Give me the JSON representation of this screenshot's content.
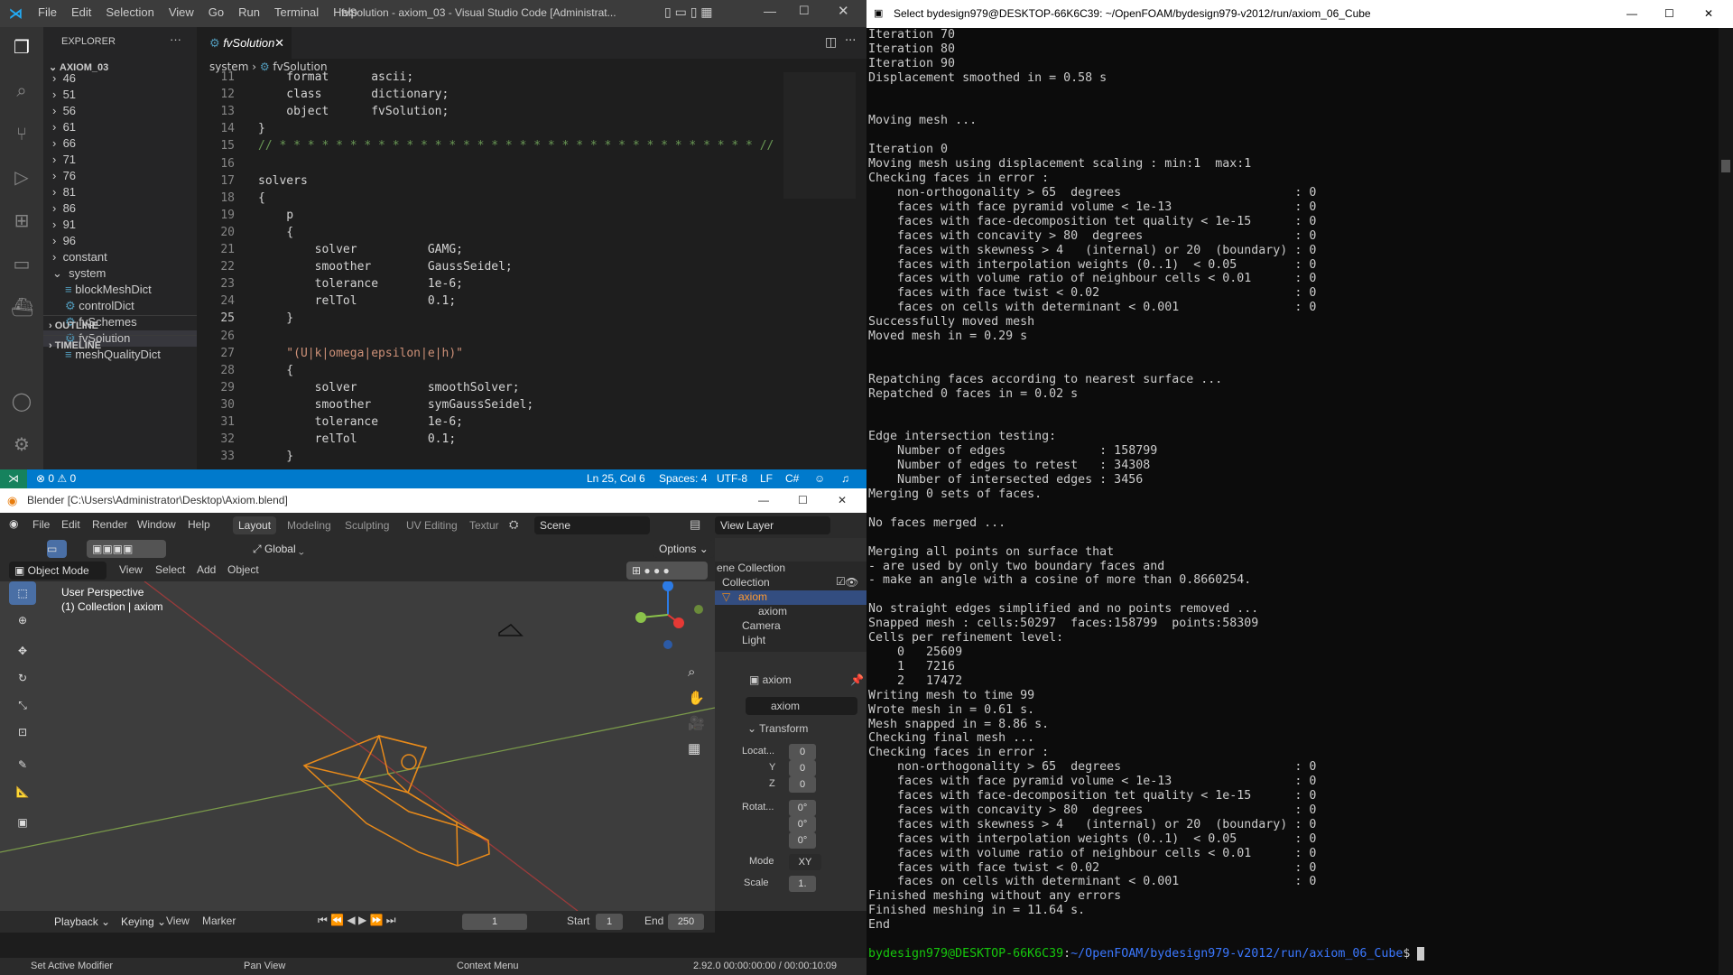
{
  "vscode": {
    "menu": [
      "File",
      "Edit",
      "Selection",
      "View",
      "Go",
      "Run",
      "Terminal",
      "Help"
    ],
    "title": "fvSolution - axiom_03 - Visual Studio Code [Administrat...",
    "explorer_label": "EXPLORER",
    "project": "AXIOM_03",
    "folders": [
      "46",
      "51",
      "56",
      "61",
      "66",
      "71",
      "76",
      "81",
      "86",
      "91",
      "96",
      "constant"
    ],
    "system_folder": "system",
    "system_files": [
      {
        "name": "blockMeshDict",
        "icon": "≡"
      },
      {
        "name": "controlDict",
        "icon": "⚙"
      },
      {
        "name": "fvSchemes",
        "icon": "⚙"
      },
      {
        "name": "fvSolution",
        "icon": "⚙"
      },
      {
        "name": "meshQualityDict",
        "icon": "≡"
      }
    ],
    "outline": "OUTLINE",
    "timeline": "TIMELINE",
    "tab": "fvSolution",
    "breadcrumb": [
      "system",
      "fvSolution"
    ],
    "code_lines": [
      {
        "n": "11",
        "t": "    format      ascii;"
      },
      {
        "n": "12",
        "t": "    class       dictionary;"
      },
      {
        "n": "13",
        "t": "    object      fvSolution;"
      },
      {
        "n": "14",
        "t": "}"
      },
      {
        "n": "15",
        "t": "// * * * * * * * * * * * * * * * * * * * * * * * * * * * * * * * * * * //"
      },
      {
        "n": "16",
        "t": ""
      },
      {
        "n": "17",
        "t": "solvers"
      },
      {
        "n": "18",
        "t": "{"
      },
      {
        "n": "19",
        "t": "    p"
      },
      {
        "n": "20",
        "t": "    {"
      },
      {
        "n": "21",
        "t": "        solver          GAMG;"
      },
      {
        "n": "22",
        "t": "        smoother        GaussSeidel;"
      },
      {
        "n": "23",
        "t": "        tolerance       1e-6;"
      },
      {
        "n": "24",
        "t": "        relTol          0.1;"
      },
      {
        "n": "25",
        "t": "    }"
      },
      {
        "n": "26",
        "t": ""
      },
      {
        "n": "27",
        "t": "    \"(U|k|omega|epsilon|e|h)\""
      },
      {
        "n": "28",
        "t": "    {"
      },
      {
        "n": "29",
        "t": "        solver          smoothSolver;"
      },
      {
        "n": "30",
        "t": "        smoother        symGaussSeidel;"
      },
      {
        "n": "31",
        "t": "        tolerance       1e-6;"
      },
      {
        "n": "32",
        "t": "        relTol          0.1;"
      },
      {
        "n": "33",
        "t": "    }"
      }
    ],
    "status": {
      "errors": "0",
      "warnings": "0",
      "position": "Ln 25, Col 6",
      "spaces": "Spaces: 4",
      "encoding": "UTF-8",
      "eol": "LF",
      "lang": "C#"
    }
  },
  "blender": {
    "title": "Blender [C:\\Users\\Administrator\\Desktop\\Axiom.blend]",
    "menu": [
      "File",
      "Edit",
      "Render",
      "Window",
      "Help"
    ],
    "workspaces": [
      "Layout",
      "Modeling",
      "Sculpting",
      "UV Editing",
      "Textur"
    ],
    "scene": "Scene",
    "view_layer": "View Layer",
    "orientation": "Global",
    "options": "Options",
    "mode": "Object Mode",
    "header_menu": [
      "View",
      "Select",
      "Add",
      "Object"
    ],
    "viewport_info": [
      "User Perspective",
      "(1) Collection | axiom"
    ],
    "outliner": {
      "root": "ene Collection",
      "collection": "Collection",
      "items": [
        "axiom",
        "axiom",
        "Camera",
        "Light"
      ]
    },
    "props": {
      "object": "axiom",
      "data": "axiom",
      "panel": "Transform",
      "loc_label": "Locat...",
      "rot_label": "Rotat...",
      "y": "Y",
      "z": "Z",
      "loc": [
        "0",
        "0",
        "0"
      ],
      "rot": [
        "0°",
        "0°",
        "0°"
      ],
      "mode_label": "Mode",
      "mode_value": "XY",
      "scale_label": "Scale",
      "scale_value": "1."
    },
    "timeline": {
      "menu": [
        "Playback",
        "Keying",
        "View",
        "Marker"
      ],
      "frame": "1",
      "start_label": "Start",
      "start": "1",
      "end_label": "End",
      "end": "250"
    },
    "statusbar": {
      "left": "Set Active Modifier",
      "mid": "Pan View",
      "ctx": "Context Menu",
      "version": "2.92.0  00:00:00:00 / 00:00:10:09"
    }
  },
  "terminal": {
    "title": "Select bydesign979@DESKTOP-66K6C39: ~/OpenFOAM/bydesign979-v2012/run/axiom_06_Cube",
    "lines": [
      "Iteration 70",
      "Iteration 80",
      "Iteration 90",
      "Displacement smoothed in = 0.58 s",
      "",
      "",
      "Moving mesh ...",
      "",
      "Iteration 0",
      "Moving mesh using displacement scaling : min:1  max:1",
      "Checking faces in error :",
      "    non-orthogonality > 65  degrees                        : 0",
      "    faces with face pyramid volume < 1e-13                 : 0",
      "    faces with face-decomposition tet quality < 1e-15      : 0",
      "    faces with concavity > 80  degrees                     : 0",
      "    faces with skewness > 4   (internal) or 20  (boundary) : 0",
      "    faces with interpolation weights (0..1)  < 0.05        : 0",
      "    faces with volume ratio of neighbour cells < 0.01      : 0",
      "    faces with face twist < 0.02                           : 0",
      "    faces on cells with determinant < 0.001                : 0",
      "Successfully moved mesh",
      "Moved mesh in = 0.29 s",
      "",
      "",
      "Repatching faces according to nearest surface ...",
      "Repatched 0 faces in = 0.02 s",
      "",
      "",
      "Edge intersection testing:",
      "    Number of edges             : 158799",
      "    Number of edges to retest   : 34308",
      "    Number of intersected edges : 3456",
      "Merging 0 sets of faces.",
      "",
      "No faces merged ...",
      "",
      "Merging all points on surface that",
      "- are used by only two boundary faces and",
      "- make an angle with a cosine of more than 0.8660254.",
      "",
      "No straight edges simplified and no points removed ...",
      "Snapped mesh : cells:50297  faces:158799  points:58309",
      "Cells per refinement level:",
      "    0   25609",
      "    1   7216",
      "    2   17472",
      "Writing mesh to time 99",
      "Wrote mesh in = 0.61 s.",
      "Mesh snapped in = 8.86 s.",
      "Checking final mesh ...",
      "Checking faces in error :",
      "    non-orthogonality > 65  degrees                        : 0",
      "    faces with face pyramid volume < 1e-13                 : 0",
      "    faces with face-decomposition tet quality < 1e-15      : 0",
      "    faces with concavity > 80  degrees                     : 0",
      "    faces with skewness > 4   (internal) or 20  (boundary) : 0",
      "    faces with interpolation weights (0..1)  < 0.05        : 0",
      "    faces with volume ratio of neighbour cells < 0.01      : 0",
      "    faces with face twist < 0.02                           : 0",
      "    faces on cells with determinant < 0.001                : 0",
      "Finished meshing without any errors",
      "Finished meshing in = 11.64 s.",
      "End"
    ],
    "prompt_user": "bydesign979@DESKTOP-66K6C39",
    "prompt_path": "~/OpenFOAM/bydesign979-v2012/run/axiom_06_Cube"
  }
}
